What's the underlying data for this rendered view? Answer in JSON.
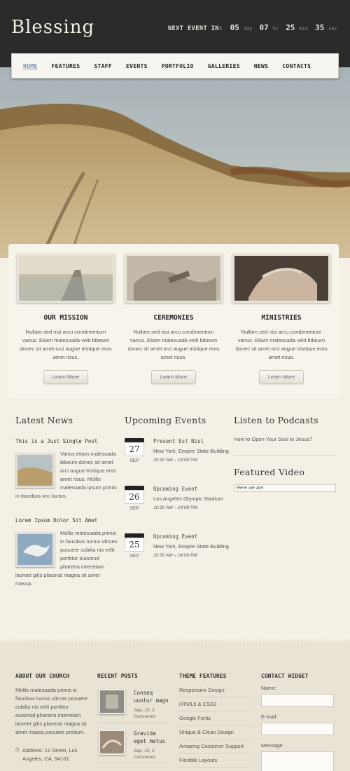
{
  "header": {
    "logo": "Blessing",
    "countdown": {
      "label": "NEXT EVENT IN:",
      "days": "05",
      "days_unit": "day",
      "hours": "07",
      "hours_unit": "hr",
      "minutes": "25",
      "minutes_unit": "min",
      "seconds": "35",
      "seconds_unit": "sec"
    }
  },
  "nav": [
    "HOME",
    "FEATURES",
    "STAFF",
    "EVENTS",
    "PORTFOLIO",
    "GALLERIES",
    "NEWS",
    "CONTACTS"
  ],
  "features": [
    {
      "title": "OUR MISSION",
      "text": "Nullam sed nisi arcu condimentum varius. Etiam malesuada velit bibeum donec sit amet orci augue tristique eros amet risus.",
      "button": "Learn More"
    },
    {
      "title": "CEREMONIES",
      "text": "Nullam sed nisi arcu condimentum varius. Etiam malesuada velit bibeum donec sit amet orci augue tristique eros amet risus.",
      "button": "Learn More"
    },
    {
      "title": "MINISTRIES",
      "text": "Nullam sed nisi arcu condimentum varius. Etiam malesuada velit bibeum donec sit amet orci augue tristique eros amet risus.",
      "button": "Learn More"
    }
  ],
  "news": {
    "title": "Latest News",
    "posts": [
      {
        "title": "This is a Just Single Post",
        "text": "Varius etiam malesuada bibeum donec sit amet orci augue tristique eros amet risus. Mollis malesuada ipsum primis in faucibus orci luctus."
      },
      {
        "title": "Lorem Ipsum Dolor Sit Amet",
        "text": "Mollis malesuada primis in faucibus luctus ultrces posuere cubilia nis velit porttitor euismod pharetra interetiam laoreet gitis placerat magna sit amet massa."
      }
    ]
  },
  "events": {
    "title": "Upcoming Events",
    "items": [
      {
        "day": "27",
        "month": "SEP",
        "title": "Present Est Nisl",
        "location": "New York, Empire State Building",
        "time": "10:30 AM – 14:00 PM"
      },
      {
        "day": "26",
        "month": "SEP",
        "title": "Upcoming Event",
        "location": "Los Angeles Olympic Stadium",
        "time": "10:30 AM – 14:00 PM"
      },
      {
        "day": "25",
        "month": "SEP",
        "title": "Upcoming Event",
        "location": "New York, Empire State Building",
        "time": "10:30 AM – 14:00 PM"
      }
    ]
  },
  "podcasts": {
    "title": "Listen to Podcasts",
    "item": "How to Open Your Soul to Jesus?"
  },
  "video": {
    "title": "Featured Video",
    "caption": "Here we are"
  },
  "footer": {
    "about": {
      "title": "ABOUT OUR CHURCH",
      "text": "Mollis malesuada primis in faucibus luctus ultrces posuere cubilia nis velit porttitor euismod pharetra interetiam laoreet gitis placerat magna sit amet massa posuere pretium.",
      "address": "Address: 12 Street, Los Angeles, CA, 94101"
    },
    "recent": {
      "title": "RECENT POSTS",
      "posts": [
        {
          "title": "Conseq uuntur magn",
          "date": "Sep, 15, 2",
          "comments": "Comments"
        },
        {
          "title": "Gravida eget metus",
          "date": "Sep, 15, 2",
          "comments": "Comments"
        }
      ]
    },
    "theme": {
      "title": "THEME FEATURES",
      "items": [
        "Responsive Design",
        "HTML5 & CSS3",
        "Google Fonts",
        "Unique & Clean Design",
        "Amazing Customer Support",
        "Flexible Layouts"
      ]
    },
    "contact": {
      "title": "CONTACT WIDGET",
      "name_label": "Name:",
      "email_label": "E-mail:",
      "message_label": "Message:"
    }
  },
  "colors": {
    "header_bg": "#2b2b2b",
    "page_bg": "#f4f0e6",
    "footer_bg": "#e8e3d4",
    "nav_active": "#7b8db0"
  }
}
